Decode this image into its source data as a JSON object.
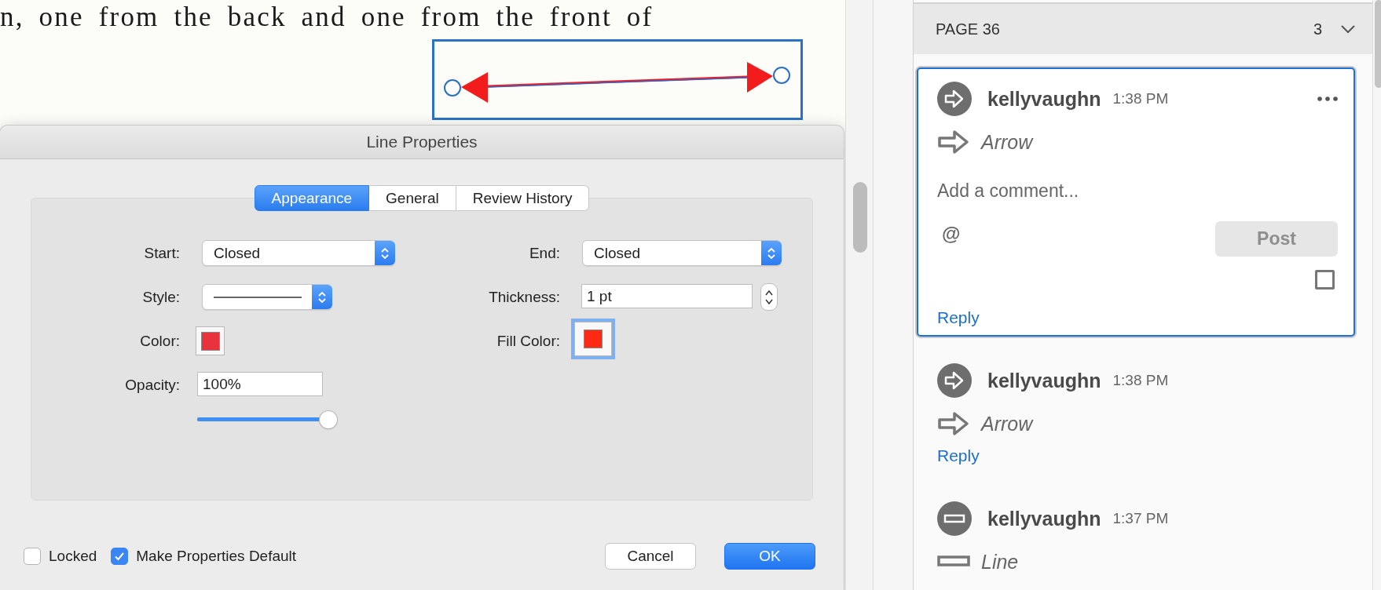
{
  "document": {
    "text": "n, one from the back and one from the front of",
    "annotation": {
      "selected": true
    }
  },
  "dialog": {
    "title": "Line Properties",
    "tabs": [
      {
        "label": "Appearance",
        "selected": true
      },
      {
        "label": "General",
        "selected": false
      },
      {
        "label": "Review History",
        "selected": false
      }
    ],
    "start": {
      "label": "Start:",
      "value": "Closed"
    },
    "style": {
      "label": "Style:"
    },
    "color": {
      "label": "Color:",
      "color": "#e8323c"
    },
    "opacity": {
      "label": "Opacity:",
      "value": "100%",
      "level": 1
    },
    "end": {
      "label": "End:",
      "value": "Closed"
    },
    "thickness": {
      "label": "Thickness:",
      "value": "1 pt"
    },
    "fill_color": {
      "label": "Fill Color:",
      "color": "#ff2a14",
      "focused": true
    },
    "checkboxes": [
      {
        "label": "Locked",
        "checked": false
      },
      {
        "label": "Make Properties Default",
        "checked": true
      }
    ],
    "buttons": [
      {
        "label": "Cancel",
        "kind": "default"
      },
      {
        "label": "OK",
        "kind": "primary"
      }
    ]
  },
  "comments_panel": {
    "page": "PAGE 36",
    "count": "3",
    "comments": [
      {
        "author": "kellyvaughn",
        "time": "1:38 PM",
        "kind": "arrow",
        "subject": "Arrow",
        "selected": true,
        "placeholder": "Add a comment...",
        "mention": "@",
        "post": "Post",
        "checked": false,
        "reply": "Reply"
      },
      {
        "author": "kellyvaughn",
        "time": "1:38 PM",
        "kind": "arrow",
        "subject": "Arrow",
        "selected": false,
        "reply": "Reply"
      },
      {
        "author": "kellyvaughn",
        "time": "1:37 PM",
        "kind": "line",
        "subject": "Line",
        "selected": false
      }
    ]
  }
}
